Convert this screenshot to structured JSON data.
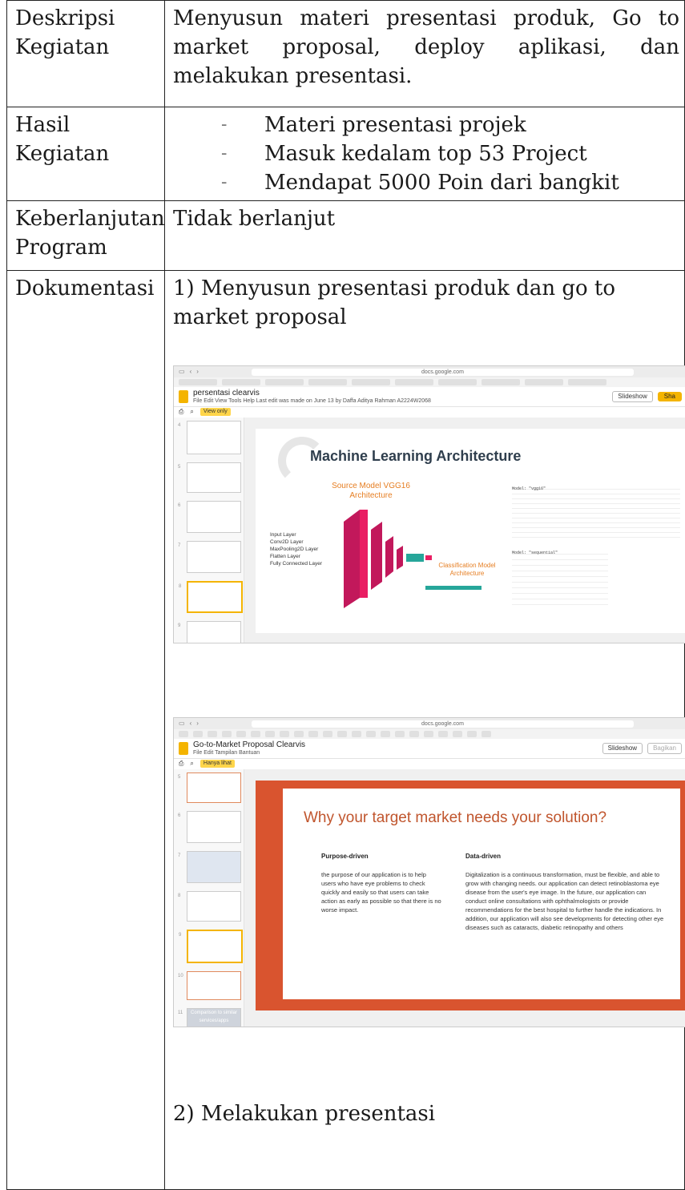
{
  "rows": {
    "deskripsi": {
      "label": "Deskripsi Kegiatan",
      "text": "Menyusun materi presentasi produk, Go to market proposal, deploy aplikasi, dan melakukan presentasi."
    },
    "hasil": {
      "label": "Hasil Kegiatan",
      "items": [
        "Materi presentasi projek",
        "Masuk kedalam top 53 Project",
        "Mendapat 5000 Poin dari bangkit"
      ]
    },
    "keberlanjutan": {
      "label": "Keberlanjutan Program",
      "text": "Tidak berlanjut"
    },
    "dokumentasi": {
      "label": "Dokumentasi",
      "step1": "1) Menyusun presentasi produk dan go to market proposal",
      "step2": "2) Melakukan presentasi"
    }
  },
  "shot1": {
    "url": "docs.google.com",
    "title": "persentasi clearvis",
    "menu": "File   Edit   View   Tools   Help     Last edit was made on June 13 by Daffa Aditya Rahman A2224W2068",
    "slideshow": "Slideshow",
    "share": "Sha",
    "view_pill": "View only",
    "slide_title": "Machine Learning Architecture",
    "source_title": "Source Model VGG16 Architecture",
    "class_title": "Classification Model Architecture",
    "legend": [
      "Input Layer",
      "Conv2D Layer",
      "MaxPooling2D Layer",
      "Flatten Layer",
      "Fully Connected Layer"
    ],
    "model_name": "Model: \"vgg16\"",
    "seq_name": "Model: \"sequential\""
  },
  "shot2": {
    "url": "docs.google.com",
    "title": "Go-to-Market Proposal Clearvis",
    "menu": "File   Edit   Tampilan   Bantuan",
    "slideshow": "Slideshow",
    "share": "Bagikan",
    "view_pill": "Hanya lihat",
    "slide_title": "Why your target market needs your solution?",
    "col1_head": "Purpose-driven",
    "col1_body": "the purpose of our application is to help users who have eye problems to check quickly and easily so that users can take action as early as possible so that there is no worse impact.",
    "col2_head": "Data-driven",
    "col2_body": "Digitalization is a continuous transformation, must be flexible, and able to grow with changing needs. our application can detect retinoblastoma eye disease from the user's eye image. In the future, our application can conduct online consultations with ophthalmologists or provide recommendations for the best hospital to further handle the indications. In addition, our application will also see developments for detecting other eye diseases such as cataracts, diabetic retinopathy and others",
    "thumb_text": "Comparison to similar services/apps"
  },
  "colors": {
    "accent": "#f4b400",
    "slide_red": "#d9542f",
    "vgg_pink": "#d81b60",
    "title_orange": "#e67e22"
  }
}
